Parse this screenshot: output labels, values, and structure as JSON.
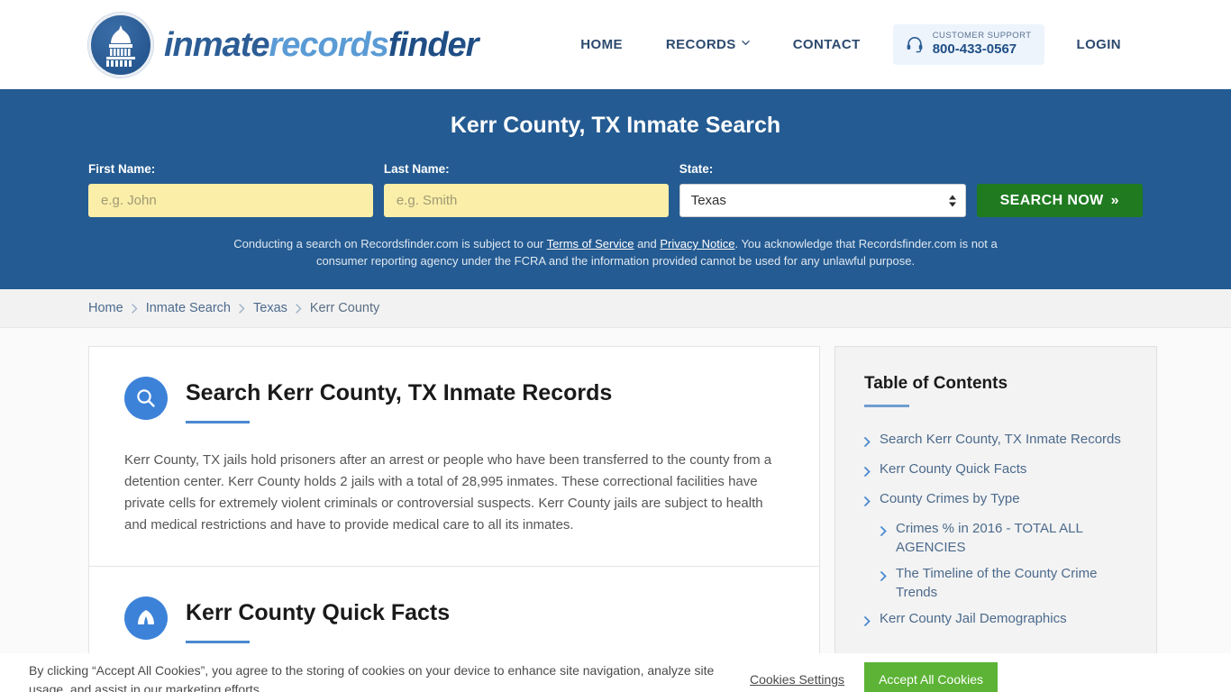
{
  "header": {
    "brand": {
      "part1": "inmate",
      "part2": "records",
      "part3": "finder",
      "icon": "capitol-dome-icon"
    },
    "nav": [
      {
        "label": "HOME"
      },
      {
        "label": "RECORDS",
        "has_caret": true
      },
      {
        "label": "CONTACT"
      }
    ],
    "support": {
      "icon": "headset-icon",
      "label": "CUSTOMER SUPPORT",
      "phone": "800-433-0567"
    },
    "login": "LOGIN"
  },
  "hero": {
    "title": "Kerr County, TX Inmate Search",
    "first_name_label": "First Name:",
    "first_name_placeholder": "e.g. John",
    "first_name_value": "",
    "last_name_label": "Last Name:",
    "last_name_placeholder": "e.g. Smith",
    "last_name_value": "",
    "state_label": "State:",
    "state_value": "Texas",
    "state_options": [
      "Texas"
    ],
    "search_button": "SEARCH NOW",
    "search_button_chevron": "»",
    "disclaimer_1": "Conducting a search on Recordsfinder.com is subject to our ",
    "disclaimer_link_1": "Terms of Service",
    "disclaimer_2": " and ",
    "disclaimer_link_2": "Privacy Notice",
    "disclaimer_3": ". You acknowledge that Recordsfinder.com is not a consumer reporting agency under the FCRA and the information provided cannot be used for any unlawful purpose.",
    "bg_color": "#245b92",
    "button_color": "#1f7a20",
    "input_color": "#fbeea8"
  },
  "breadcrumb": [
    {
      "label": "Home"
    },
    {
      "label": "Inmate Search"
    },
    {
      "label": "Texas"
    },
    {
      "label": "Kerr County"
    }
  ],
  "main": {
    "section1": {
      "icon": "search-icon",
      "title": "Search Kerr County, TX Inmate Records",
      "body": "Kerr County, TX jails hold prisoners after an arrest or people who have been transferred to the county from a detention center. Kerr County holds 2 jails with a total of 28,995 inmates. These correctional facilities have private cells for extremely violent criminals or controversial suspects. Kerr County jails are subject to health and medical restrictions and have to provide medical care to all its inmates."
    },
    "section2": {
      "icon": "info-dome-icon",
      "title": "Kerr County Quick Facts"
    }
  },
  "sidebar": {
    "title": "Table of Contents",
    "items": [
      {
        "label": "Search Kerr County, TX Inmate Records",
        "sub": false
      },
      {
        "label": "Kerr County Quick Facts",
        "sub": false
      },
      {
        "label": "County Crimes by Type",
        "sub": false
      },
      {
        "label": "Crimes % in 2016 - TOTAL ALL AGENCIES",
        "sub": true
      },
      {
        "label": "The Timeline of the County Crime Trends",
        "sub": true
      },
      {
        "label": "Kerr County Jail Demographics",
        "sub": false
      }
    ]
  },
  "cookie_bar": {
    "text": "By clicking “Accept All Cookies”, you agree to the storing of cookies on your device to enhance site navigation, analyze site usage, and assist in our marketing efforts.",
    "settings_label": "Cookies Settings",
    "accept_label": "Accept All Cookies",
    "accept_color": "#5cb335"
  }
}
